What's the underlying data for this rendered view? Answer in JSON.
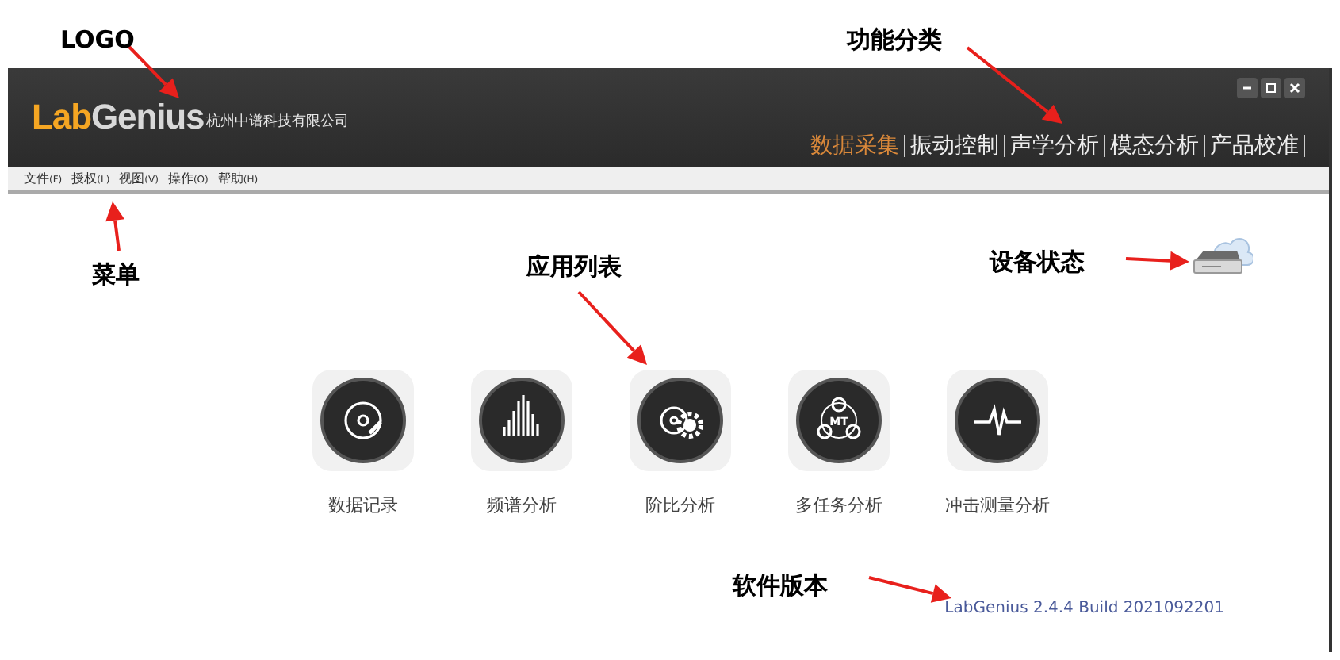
{
  "annotations": [
    {
      "label": "LOGO"
    },
    {
      "label": "功能分类"
    },
    {
      "label": "菜单"
    },
    {
      "label": "应用列表"
    },
    {
      "label": "设备状态"
    },
    {
      "label": "软件版本"
    }
  ],
  "logo": {
    "part_1": "Lab",
    "part_2": "Genius",
    "company": "杭州中谱科技有限公司"
  },
  "nav_tabs": [
    {
      "label": "数据采集",
      "selected": true
    },
    {
      "label": "振动控制",
      "selected": false
    },
    {
      "label": "声学分析",
      "selected": false
    },
    {
      "label": "模态分析",
      "selected": false
    },
    {
      "label": "产品校准",
      "selected": false
    }
  ],
  "menu": [
    {
      "label": "文件",
      "key": "(F)"
    },
    {
      "label": "授权",
      "key": "(L)"
    },
    {
      "label": "视图",
      "key": "(V)"
    },
    {
      "label": "操作",
      "key": "(O)"
    },
    {
      "label": "帮助",
      "key": "(H)"
    }
  ],
  "apps": [
    {
      "kind": "record",
      "label": "数据记录"
    },
    {
      "kind": "spectrum",
      "label": "频谱分析"
    },
    {
      "kind": "order",
      "label": "阶比分析"
    },
    {
      "kind": "multitask",
      "label": "多任务分析",
      "badge": "MT"
    },
    {
      "kind": "shock",
      "label": "冲击测量分析"
    }
  ],
  "version": "LabGenius 2.4.4 Build 2021092201"
}
